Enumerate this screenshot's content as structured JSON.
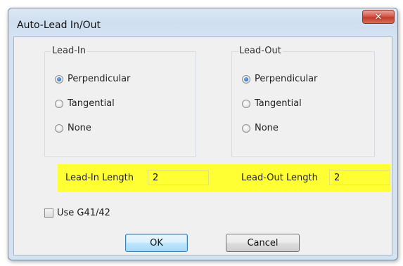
{
  "window": {
    "title": "Auto-Lead In/Out",
    "close_glyph": "✕"
  },
  "lead_in": {
    "legend": "Lead-In",
    "options": [
      {
        "label": "Perpendicular",
        "checked": true
      },
      {
        "label": "Tangential",
        "checked": false
      },
      {
        "label": "None",
        "checked": false
      }
    ]
  },
  "lead_out": {
    "legend": "Lead-Out",
    "options": [
      {
        "label": "Perpendicular",
        "checked": true
      },
      {
        "label": "Tangential",
        "checked": false
      },
      {
        "label": "None",
        "checked": false
      }
    ]
  },
  "lengths": {
    "lead_in_label": "Lead-In Length",
    "lead_in_value": "2",
    "lead_out_label": "Lead-Out Length",
    "lead_out_value": "2",
    "highlight_color": "#ffff33"
  },
  "use_g41": {
    "label": "Use G41/42",
    "checked": false
  },
  "buttons": {
    "ok": "OK",
    "cancel": "Cancel"
  }
}
